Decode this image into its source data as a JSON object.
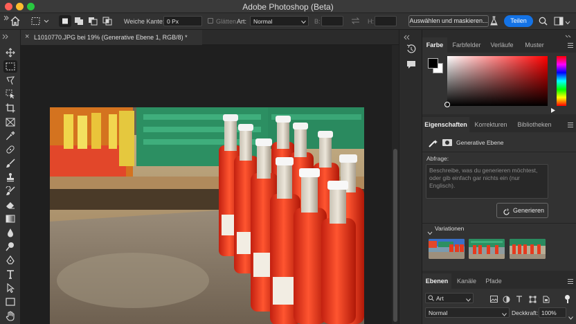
{
  "window": {
    "title": "Adobe Photoshop (Beta)"
  },
  "options_bar": {
    "feather_label": "Weiche Kante:",
    "feather_value": "0 Px",
    "antialias_label": "Glätten",
    "style_label": "Art:",
    "style_value": "Normal",
    "width_label": "B:",
    "height_label": "H:",
    "select_mask_label": "Auswählen und maskieren...",
    "share_label": "Teilen"
  },
  "document": {
    "tab_title": "L1010770.JPG bei 19% (Generative Ebene 1, RGB/8) *",
    "close_glyph": "×"
  },
  "color_panel": {
    "tabs": [
      "Farbe",
      "Farbfelder",
      "Verläufe",
      "Muster"
    ],
    "foreground": "#000000",
    "background": "#ffffff",
    "hue_color": "#ff0000"
  },
  "properties_panel": {
    "tabs": [
      "Eigenschaften",
      "Korrekturen",
      "Bibliotheken"
    ],
    "layer_type": "Generative Ebene",
    "prompt_label": "Abfrage:",
    "prompt_placeholder": "Beschreibe, was du generieren möchtest, oder gib einfach gar nichts ein (nur Englisch).",
    "generate_label": "Generieren",
    "variations_label": "Variationen"
  },
  "layers_panel": {
    "tabs": [
      "Ebenen",
      "Kanäle",
      "Pfade"
    ],
    "filter_kind": "Art",
    "blend_mode": "Normal",
    "opacity_label": "Deckkraft:",
    "opacity_value": "100%"
  },
  "colors": {
    "accent": "#1473e6",
    "panel_bg": "#323232",
    "canvas_bg": "#1f1f1f"
  }
}
